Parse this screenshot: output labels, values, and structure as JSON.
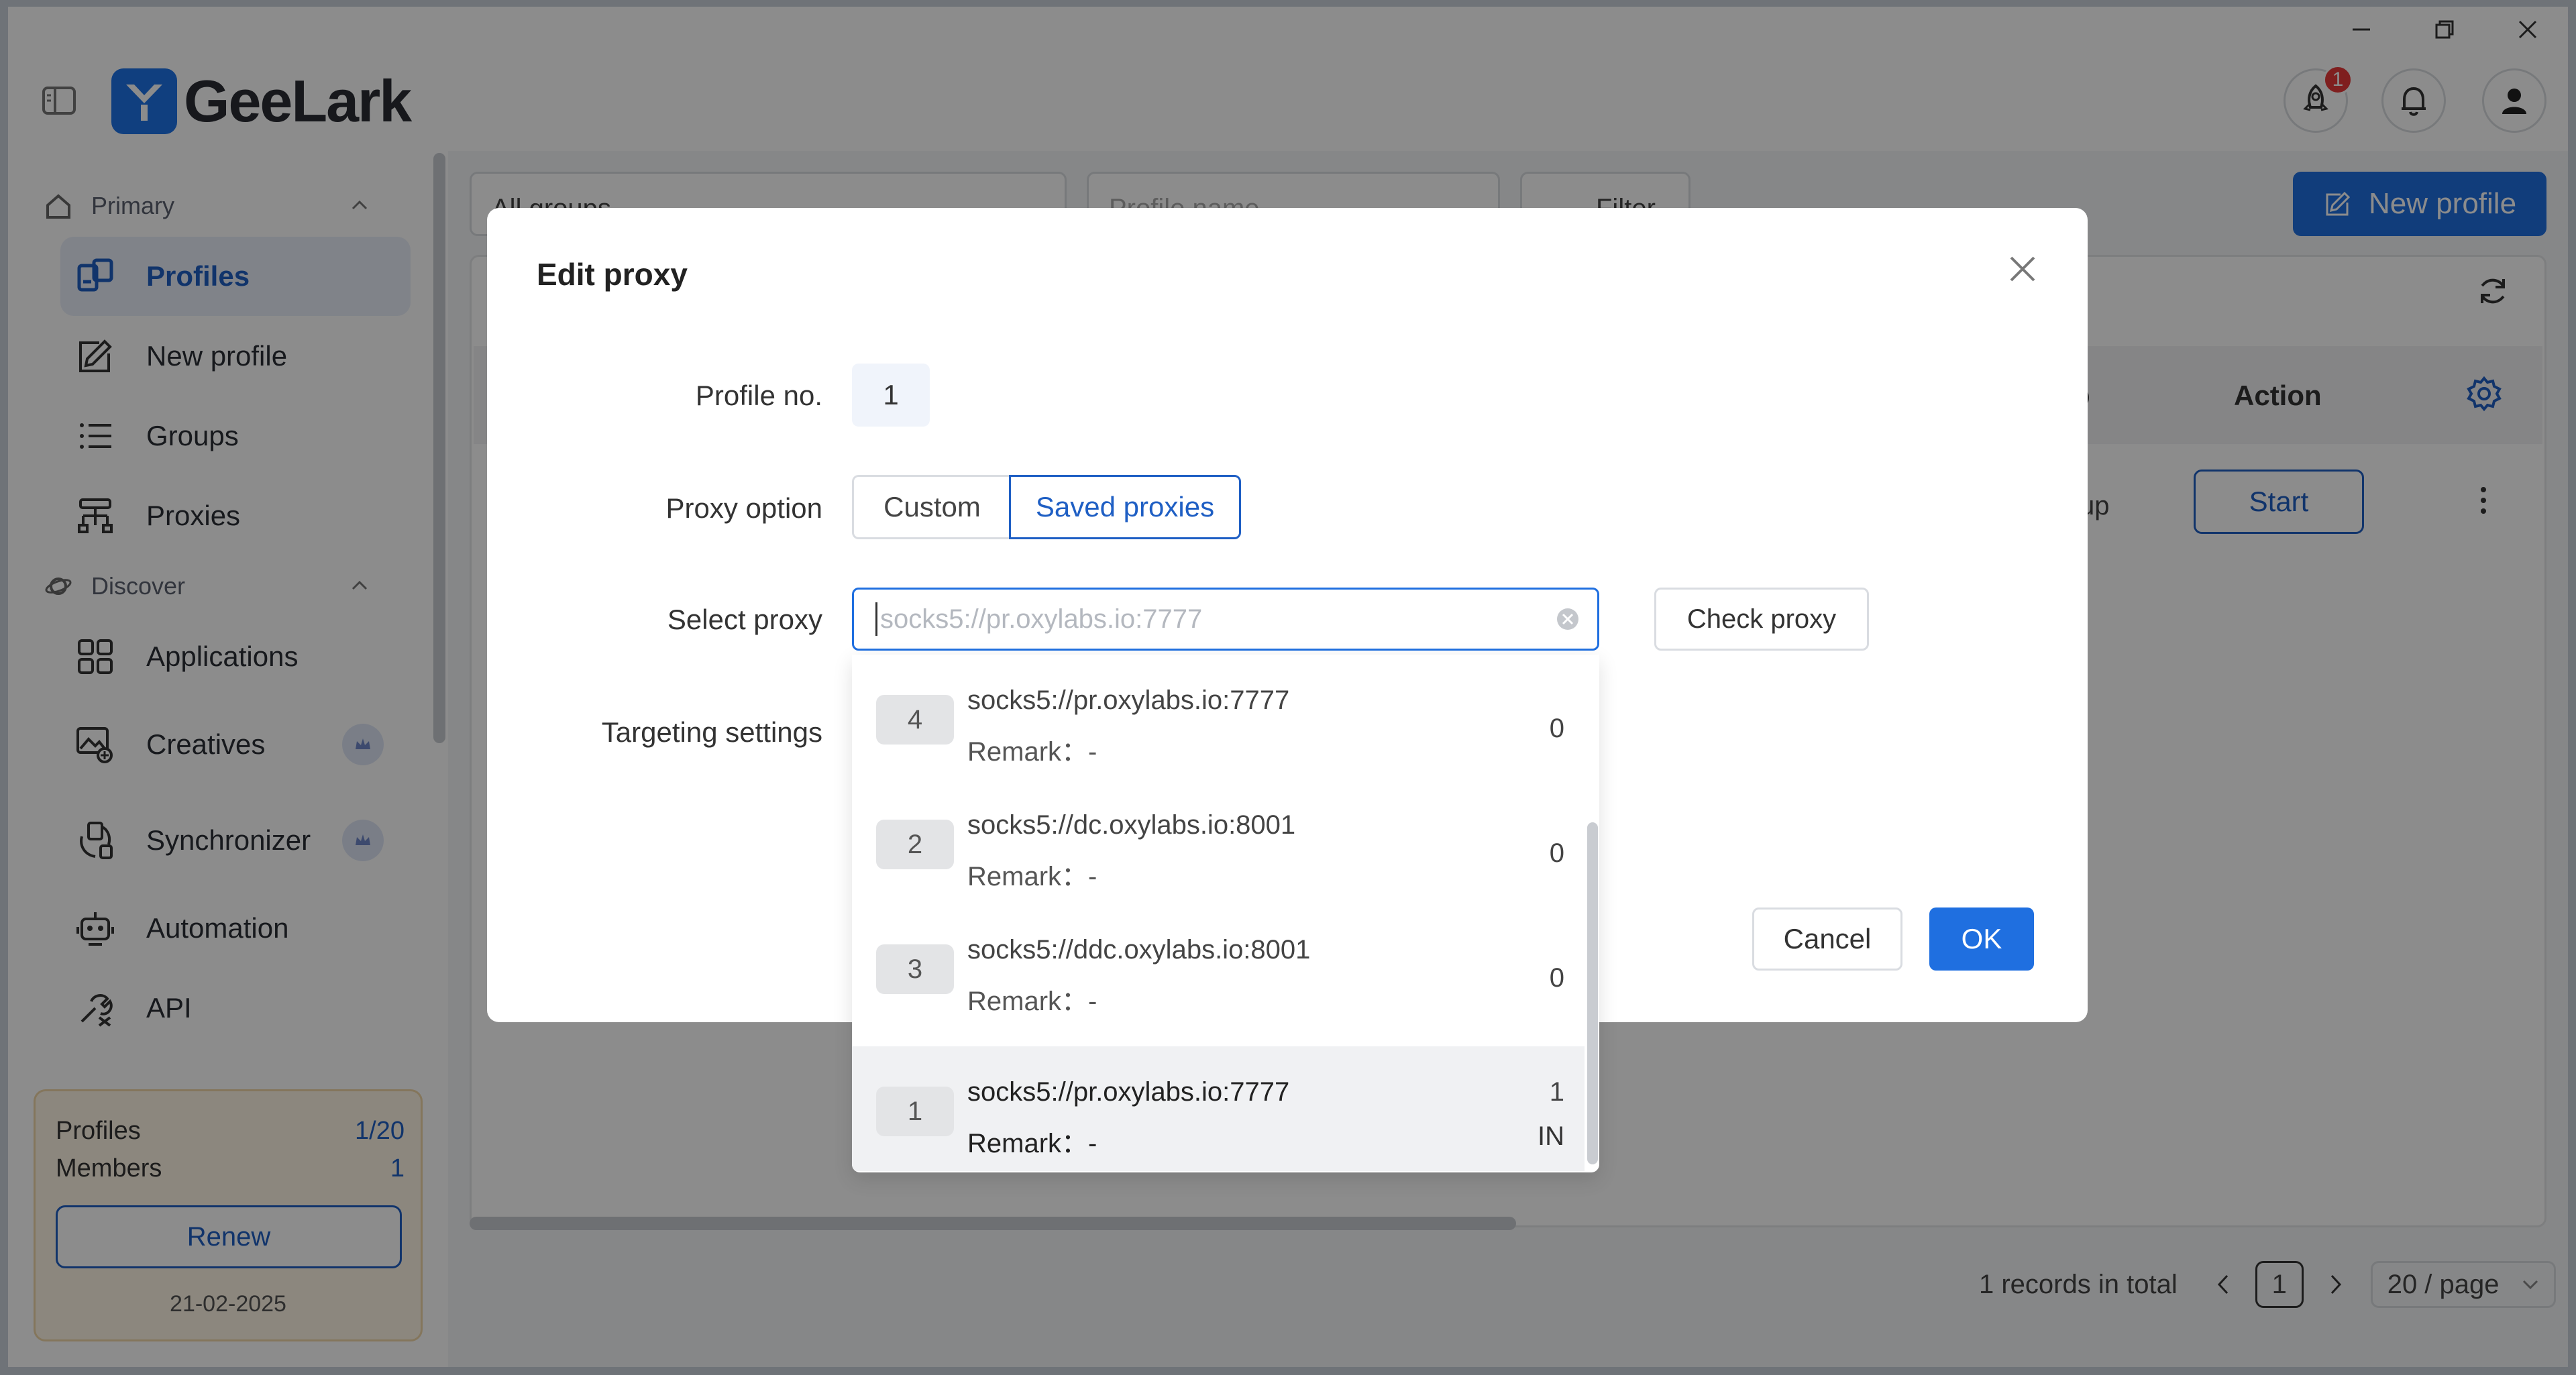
{
  "app": {
    "name": "GeeLark"
  },
  "header": {
    "notification_badge": "1"
  },
  "sidebar": {
    "sections": [
      {
        "label": "Primary"
      },
      {
        "label": "Discover"
      }
    ],
    "items": [
      {
        "label": "Profiles",
        "icon": "profiles-icon",
        "active": true
      },
      {
        "label": "New profile",
        "icon": "edit-icon"
      },
      {
        "label": "Groups",
        "icon": "list-icon"
      },
      {
        "label": "Proxies",
        "icon": "proxies-icon"
      },
      {
        "label": "Applications",
        "icon": "grid-icon"
      },
      {
        "label": "Creatives",
        "icon": "image-icon"
      },
      {
        "label": "Synchronizer",
        "icon": "sync-icon"
      },
      {
        "label": "Automation",
        "icon": "robot-icon"
      },
      {
        "label": "API",
        "icon": "api-icon"
      }
    ],
    "plan": {
      "profiles_label": "Profiles",
      "profiles_value": "1/20",
      "members_label": "Members",
      "members_value": "1",
      "renew_label": "Renew",
      "date": "21-02-2025"
    }
  },
  "toolbar": {
    "group_select": "All groups",
    "search_placeholder": "Profile name",
    "filter_label": "Filter",
    "new_profile_label": "New profile"
  },
  "table": {
    "column_partial": "p",
    "column_action": "Action",
    "row_partial": "up",
    "start_label": "Start"
  },
  "pagination": {
    "total_text": "1 records in total",
    "current_page": "1",
    "page_size": "20 / page"
  },
  "modal": {
    "title": "Edit proxy",
    "profile_no_label": "Profile no.",
    "profile_no_value": "1",
    "proxy_option_label": "Proxy option",
    "options": [
      "Custom",
      "Saved proxies"
    ],
    "selected_option": "Saved proxies",
    "select_proxy_label": "Select proxy",
    "select_proxy_placeholder": "socks5://pr.oxylabs.io:7777",
    "check_proxy_label": "Check proxy",
    "targeting_label": "Targeting settings",
    "cancel_label": "Cancel",
    "ok_label": "OK"
  },
  "dropdown": {
    "items": [
      {
        "num": "4",
        "url": "socks5://pr.oxylabs.io:7777",
        "remark": "Remark：-",
        "count": "0"
      },
      {
        "num": "2",
        "url": "socks5://dc.oxylabs.io:8001",
        "remark": "Remark：-",
        "count": "0"
      },
      {
        "num": "3",
        "url": "socks5://ddc.oxylabs.io:8001",
        "remark": "Remark：-",
        "count": "0"
      },
      {
        "num": "1",
        "url": "socks5://pr.oxylabs.io:7777",
        "remark": "Remark：-",
        "count": "1",
        "country": "IN",
        "selected": true
      }
    ]
  },
  "colors": {
    "accent": "#1f6fe0",
    "active_nav_bg": "#e9effa",
    "badge": "#e83a3a",
    "overlay": "rgba(0,0,0,0.45)"
  }
}
